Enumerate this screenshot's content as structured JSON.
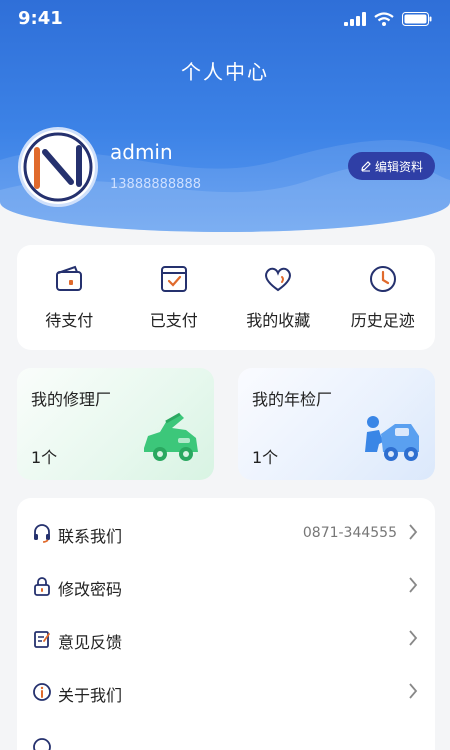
{
  "status_bar": {
    "time": "9:41"
  },
  "header": {
    "title": "个人中心",
    "username": "admin",
    "phone": "13888888888",
    "edit_label": "编辑资料"
  },
  "orders": [
    {
      "label": "待支付",
      "icon": "wallet-icon"
    },
    {
      "label": "已支付",
      "icon": "paid-check-icon"
    },
    {
      "label": "我的收藏",
      "icon": "heart-icon"
    },
    {
      "label": "历史足迹",
      "icon": "clock-icon"
    }
  ],
  "factories": [
    {
      "title": "我的修理厂",
      "count": "1个",
      "icon": "repair-car-icon"
    },
    {
      "title": "我的年检厂",
      "count": "1个",
      "icon": "inspection-car-icon"
    }
  ],
  "menu": [
    {
      "label": "联系我们",
      "value": "0871-344555",
      "icon": "headset-icon"
    },
    {
      "label": "修改密码",
      "value": "",
      "icon": "lock-icon"
    },
    {
      "label": "意见反馈",
      "value": "",
      "icon": "feedback-icon"
    },
    {
      "label": "关于我们",
      "value": "",
      "icon": "info-icon"
    }
  ],
  "colors": {
    "header_blue": "#2f6fd8",
    "edit_button": "#2f3fa6",
    "icon_navy": "#25316e",
    "accent_orange": "#e06a2c",
    "repair_green": "#3cc77a",
    "inspect_blue": "#3a86e6"
  }
}
